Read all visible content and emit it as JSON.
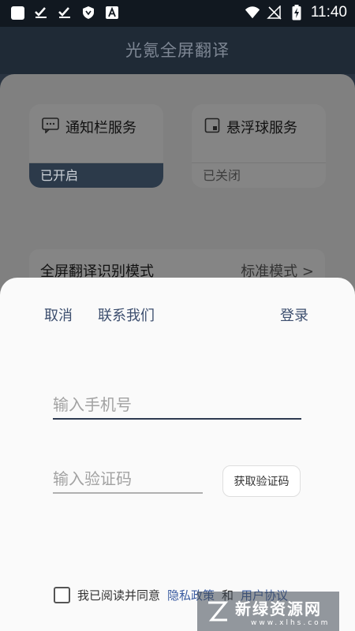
{
  "status_bar": {
    "time": "11:40",
    "colors": {
      "background": "#111820",
      "text": "#ffffff"
    }
  },
  "app": {
    "title": "光氪全屏翻译"
  },
  "cards": [
    {
      "label": "通知栏服务",
      "status": "已开启",
      "icon": "message-icon"
    },
    {
      "label": "悬浮球服务",
      "status": "已关闭",
      "icon": "square-icon"
    }
  ],
  "mode": {
    "label": "全屏翻译识别模式",
    "value": "标准模式 >"
  },
  "login_sheet": {
    "cancel": "取消",
    "contact": "联系我们",
    "login": "登录",
    "phone_placeholder": "输入手机号",
    "code_placeholder": "输入验证码",
    "get_code": "获取验证码",
    "agree_text": "我已阅读并同意",
    "privacy": "隐私政策",
    "and": "和",
    "terms": "用户协议",
    "accent_color": "#3c4e6e"
  },
  "watermark": {
    "main": "新绿资源网",
    "sub": "www.xlhs.com"
  }
}
